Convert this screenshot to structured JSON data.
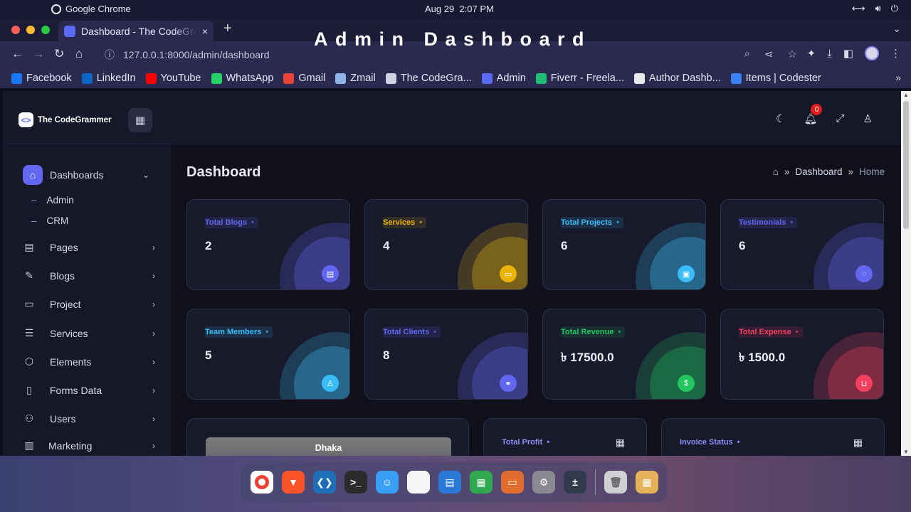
{
  "os": {
    "app_name": "Google Chrome",
    "date": "Aug 29",
    "time": "2:07 PM"
  },
  "overlay_title": "Admin Dashboard",
  "browser": {
    "tab_title": "Dashboard - The CodeGrammer",
    "tab_close": "×",
    "new_tab": "+",
    "url": "127.0.0.1:8000/admin/dashboard",
    "bookmarks": [
      {
        "label": "Facebook",
        "color": "#1877f2"
      },
      {
        "label": "LinkedIn",
        "color": "#0a66c2"
      },
      {
        "label": "YouTube",
        "color": "#ff0000"
      },
      {
        "label": "WhatsApp",
        "color": "#25d366"
      },
      {
        "label": "Gmail",
        "color": "#ea4335"
      },
      {
        "label": "Zmail",
        "color": "#8fb4e8"
      },
      {
        "label": "The CodeGra...",
        "color": "#cfd2e0"
      },
      {
        "label": "Admin",
        "color": "#5b6af5"
      },
      {
        "label": "Fiverr - Freela...",
        "color": "#1dbf73"
      },
      {
        "label": "Author Dashb...",
        "color": "#e8e8e8"
      },
      {
        "label": "Items | Codester",
        "color": "#3b82f6"
      }
    ]
  },
  "brand": {
    "name": "The CodeGrammer"
  },
  "sidebar": {
    "items": [
      {
        "label": "Dashboards",
        "icon": "home-icon"
      },
      {
        "label": "Pages",
        "icon": "layout-icon"
      },
      {
        "label": "Blogs",
        "icon": "edit-icon"
      },
      {
        "label": "Project",
        "icon": "monitor-icon"
      },
      {
        "label": "Services",
        "icon": "server-icon"
      },
      {
        "label": "Elements",
        "icon": "box-icon"
      },
      {
        "label": "Forms Data",
        "icon": "file-icon"
      },
      {
        "label": "Users",
        "icon": "users-icon"
      },
      {
        "label": "Marketing",
        "icon": "bar-chart-icon"
      }
    ],
    "subitems": [
      {
        "label": "Admin"
      },
      {
        "label": "CRM"
      }
    ]
  },
  "header": {
    "notification_count": "0"
  },
  "main": {
    "title": "Dashboard",
    "breadcrumb": [
      "Dashboard",
      "Home"
    ]
  },
  "stats": [
    {
      "label": "Total Blogs",
      "value": "2",
      "accent": "#6366f1",
      "icon": "book-icon"
    },
    {
      "label": "Services",
      "value": "4",
      "accent": "#eab308",
      "icon": "laptop-icon"
    },
    {
      "label": "Total Projects",
      "value": "6",
      "accent": "#38bdf8",
      "icon": "briefcase-icon"
    },
    {
      "label": "Testimonials",
      "value": "6",
      "accent": "#6366f1",
      "icon": "chat-icon"
    },
    {
      "label": "Team Members",
      "value": "5",
      "accent": "#38bdf8",
      "icon": "user-icon"
    },
    {
      "label": "Total Clients",
      "value": "8",
      "accent": "#6366f1",
      "icon": "handshake-icon"
    },
    {
      "label": "Total Revenue",
      "value": "৳ 17500.0",
      "accent": "#22c55e",
      "icon": "dollar-icon"
    },
    {
      "label": "Total Expense",
      "value": "৳ 1500.0",
      "accent": "#f43f5e",
      "icon": "basket-icon"
    }
  ],
  "widgets": {
    "weather_city": "Dhaka",
    "profit_label": "Total Profit",
    "invoice_label": "Invoice Status"
  },
  "dock": [
    {
      "name": "chrome",
      "color": "#ffffff"
    },
    {
      "name": "brave",
      "color": "#fb542b"
    },
    {
      "name": "vscode",
      "color": "#1f6fb8"
    },
    {
      "name": "terminal",
      "color": "#2b2b2b"
    },
    {
      "name": "finder",
      "color": "#3aa0f5"
    },
    {
      "name": "photos",
      "color": "#f6f6f6"
    },
    {
      "name": "writer",
      "color": "#2b79d6"
    },
    {
      "name": "calc",
      "color": "#2fa84f"
    },
    {
      "name": "impress",
      "color": "#e06d2d"
    },
    {
      "name": "settings",
      "color": "#8a8a92"
    },
    {
      "name": "calculator",
      "color": "#303a4a"
    },
    {
      "name": "trash",
      "color": "#cfd0d4"
    },
    {
      "name": "app-grid",
      "color": "#e5b25a"
    }
  ]
}
